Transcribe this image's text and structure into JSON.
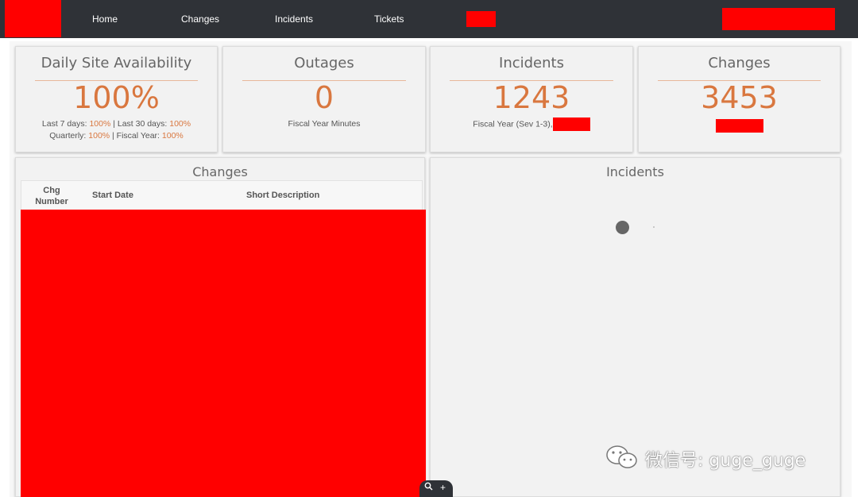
{
  "nav": {
    "items": [
      "Home",
      "Changes",
      "Incidents",
      "Tickets"
    ]
  },
  "cards": [
    {
      "title": "Daily Site Availability",
      "value": "100%",
      "line1": {
        "pre": "Last 7 days: ",
        "v1": "100%",
        "mid": " | Last 30 days: ",
        "v2": "100%"
      },
      "line2": {
        "pre": "Quarterly: ",
        "v1": "100%",
        "mid": " | Fiscal Year: ",
        "v2": "100%"
      }
    },
    {
      "title": "Outages",
      "value": "0",
      "sub": "Fiscal Year Minutes"
    },
    {
      "title": "Incidents",
      "value": "1243",
      "sub": "Fiscal Year (Sev 1-3),"
    },
    {
      "title": "Changes",
      "value": "3453"
    }
  ],
  "changes_panel": {
    "title": "Changes",
    "columns": [
      "Chg Number",
      "Start Date",
      "Short Description"
    ]
  },
  "incidents_panel": {
    "title": "Incidents"
  },
  "zoom": {
    "zoom_icon": "magnifier-icon",
    "plus_label": "+"
  },
  "watermark": {
    "icon": "wechat-icon",
    "text": "微信号: guge_guge"
  },
  "colors": {
    "accent": "#d9773f",
    "nav_bg": "#2f3237",
    "redaction": "#ff0000"
  }
}
